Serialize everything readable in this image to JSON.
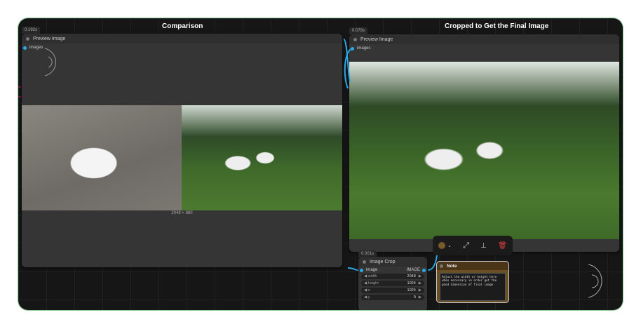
{
  "groups": {
    "left": "Comparison",
    "right": "Cropped to Get the Final Image"
  },
  "left_node": {
    "timing": "0.192s",
    "title": "Preview Image",
    "input": "images",
    "caption": "2048 × 880"
  },
  "right_node": {
    "timing": "0.079s",
    "title": "Preview Image",
    "input": "images"
  },
  "crop_node": {
    "timing": "0.001s",
    "title": "Image Crop",
    "input": "image",
    "output": "IMAGE",
    "widgets": [
      {
        "label": "width",
        "value": "2048"
      },
      {
        "label": "height",
        "value": "1024"
      },
      {
        "label": "x",
        "value": "1024"
      },
      {
        "label": "y",
        "value": "0"
      }
    ]
  },
  "toolbar": {
    "color": "#7a5a2a",
    "icons": [
      "color-picker",
      "bypass-icon",
      "pin-icon",
      "trash-icon"
    ]
  },
  "note": {
    "title": "Note",
    "text": "Adjust the width or height here when necessary in order get the good dimension of final image"
  },
  "colors": {
    "link": "#29a9e6",
    "trash": "#e04040"
  }
}
